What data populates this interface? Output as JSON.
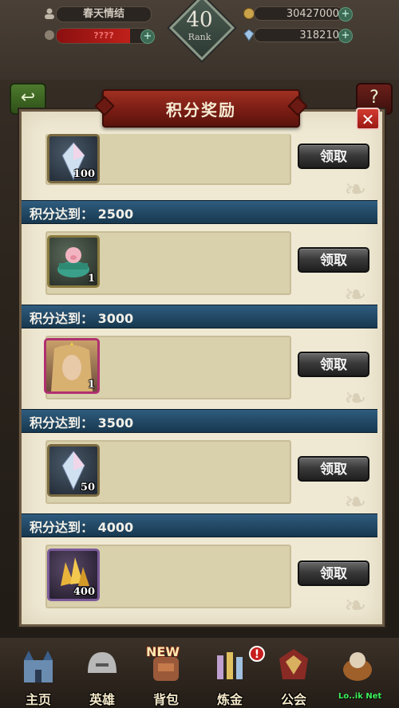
{
  "hud": {
    "player_name": "春天情结",
    "exp_text": "????",
    "rank_number": "40",
    "rank_label": "Rank",
    "coins": "30427000",
    "gems": "318210",
    "back_glyph": "↩",
    "help_glyph": "?"
  },
  "dialog": {
    "title": "积分奖励",
    "close_glyph": "✕",
    "rows": [
      {
        "header": "",
        "item_icon": "crystal-icon",
        "quantity": "100",
        "claim_label": "领取"
      },
      {
        "header": "积分达到：  2500",
        "item_icon": "pig-chest-icon",
        "quantity": "1",
        "claim_label": "领取"
      },
      {
        "header": "积分达到：  3000",
        "item_icon": "hero-portrait-icon",
        "quantity": "1",
        "claim_label": "领取"
      },
      {
        "header": "积分达到：  3500",
        "item_icon": "crystal-icon",
        "quantity": "50",
        "claim_label": "领取"
      },
      {
        "header": "积分达到：  4000",
        "item_icon": "gold-crystal-icon",
        "quantity": "400",
        "claim_label": "领取"
      }
    ]
  },
  "bottom_nav": {
    "items": [
      {
        "label": "主页",
        "icon": "castle-icon"
      },
      {
        "label": "英雄",
        "icon": "helmet-icon"
      },
      {
        "label": "背包",
        "icon": "backpack-icon"
      },
      {
        "label": "炼金",
        "icon": "alchemy-icon"
      },
      {
        "label": "公会",
        "icon": "guild-icon"
      },
      {
        "label": "",
        "icon": "shop-icon"
      }
    ],
    "new_badge": "NEW",
    "alert_badge": "!"
  },
  "watermark": "Lo..ik Net",
  "colors": {
    "header_blue": "#17384f",
    "dialog_bg": "#efe9d4",
    "title_red": "#7a1d14",
    "claim_button": "#3a3a3a"
  }
}
